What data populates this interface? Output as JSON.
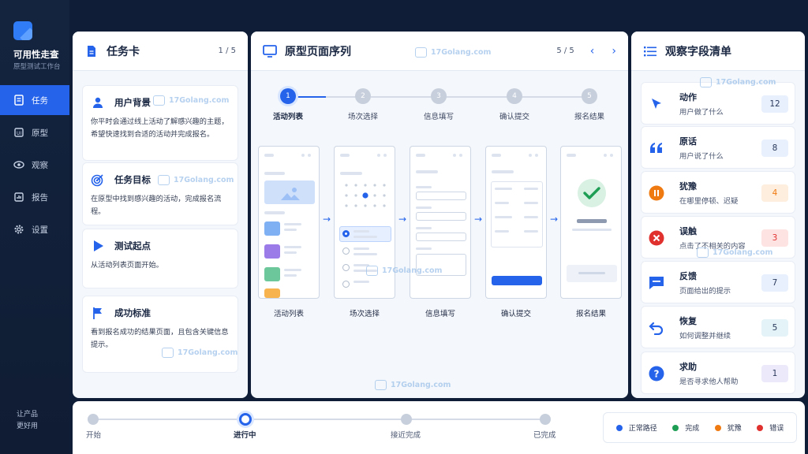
{
  "sidebar": {
    "app_title": "可用性走查",
    "app_subtitle": "原型测试工作台",
    "items": [
      {
        "label": "任务",
        "icon": "user-icon",
        "active": true
      },
      {
        "label": "原型",
        "icon": "prototype-icon",
        "active": false
      },
      {
        "label": "观察",
        "icon": "eye-icon",
        "active": false
      },
      {
        "label": "报告",
        "icon": "report-icon",
        "active": false
      },
      {
        "label": "设置",
        "icon": "gear-icon",
        "active": false
      }
    ],
    "slogan_line1": "让产品",
    "slogan_line2": "更好用"
  },
  "task_panel": {
    "title": "任务卡",
    "page": "1 / 5",
    "cards": [
      {
        "title": "用户背景",
        "icon": "user-icon",
        "body": "你平时会通过线上活动了解感兴趣的主题，希望快速找到合适的活动并完成报名。"
      },
      {
        "title": "任务目标",
        "icon": "target-icon",
        "body": "在原型中找到感兴趣的活动，完成报名流程。"
      },
      {
        "title": "测试起点",
        "icon": "play-icon",
        "body": "从活动列表页面开始。"
      },
      {
        "title": "成功标准",
        "icon": "flag-icon",
        "body": "看到报名成功的结果页面，且包含关键信息提示。"
      }
    ]
  },
  "sequence_panel": {
    "title": "原型页面序列",
    "page": "5 / 5",
    "steps": [
      {
        "num": "1",
        "label": "活动列表"
      },
      {
        "num": "2",
        "label": "场次选择"
      },
      {
        "num": "3",
        "label": "信息填写"
      },
      {
        "num": "4",
        "label": "确认提交"
      },
      {
        "num": "5",
        "label": "报名结果"
      }
    ],
    "screens": [
      "活动列表",
      "场次选择",
      "信息填写",
      "确认提交",
      "报名结果"
    ]
  },
  "obs_panel": {
    "title": "观察字段清单",
    "items": [
      {
        "title": "动作",
        "desc": "用户做了什么",
        "count": "12",
        "icon": "cursor-icon",
        "color": "#2563eb",
        "bg": "#e8f0fe"
      },
      {
        "title": "原话",
        "desc": "用户说了什么",
        "count": "8",
        "icon": "quote-icon",
        "color": "#2563eb",
        "bg": "#e8f0fe"
      },
      {
        "title": "犹豫",
        "desc": "在哪里停顿、迟疑",
        "count": "4",
        "icon": "pause-icon",
        "color": "#f07a12",
        "bg": "#fdeedd"
      },
      {
        "title": "误触",
        "desc": "点击了不相关的内容",
        "count": "3",
        "icon": "error-icon",
        "color": "#e0312f",
        "bg": "#fde4e3"
      },
      {
        "title": "反馈",
        "desc": "页面给出的提示",
        "count": "7",
        "icon": "message-icon",
        "color": "#2563eb",
        "bg": "#e8f0fe"
      },
      {
        "title": "恢复",
        "desc": "如何调整并继续",
        "count": "5",
        "icon": "undo-icon",
        "color": "#2563eb",
        "bg": "#e3f3f7"
      },
      {
        "title": "求助",
        "desc": "是否寻求他人帮助",
        "count": "1",
        "icon": "help-icon",
        "color": "#2563eb",
        "bg": "#ece9fb"
      }
    ]
  },
  "progress": {
    "stages": [
      "开始",
      "进行中",
      "接近完成",
      "已完成"
    ],
    "current_index": 1
  },
  "legend": [
    {
      "label": "正常路径",
      "color": "#2563eb"
    },
    {
      "label": "完成",
      "color": "#1e9e55"
    },
    {
      "label": "犹豫",
      "color": "#f07a12"
    },
    {
      "label": "错误",
      "color": "#e0312f"
    }
  ],
  "watermark": "17Golang.com"
}
